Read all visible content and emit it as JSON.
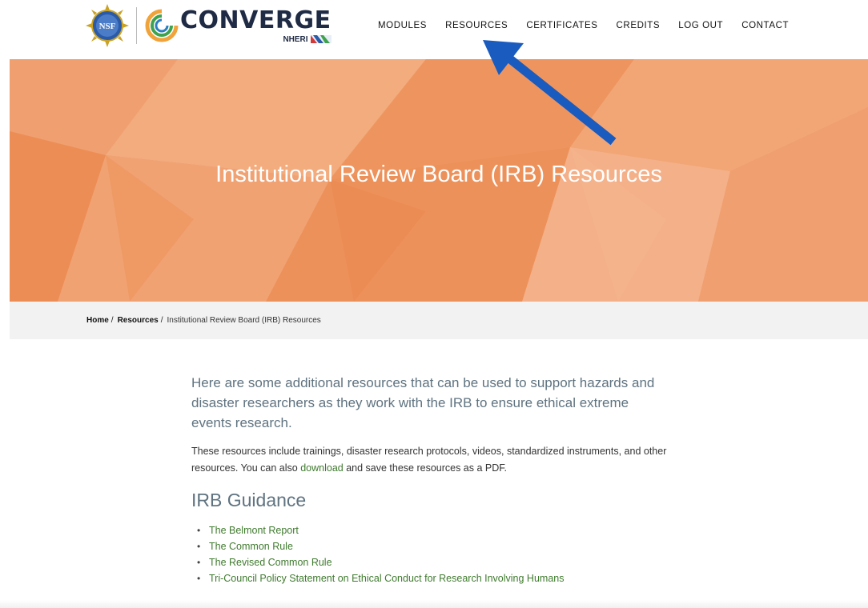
{
  "header": {
    "nsf_seal_text": "NSF",
    "brand": "CONVERGE",
    "brand_sub": "NHERI"
  },
  "nav": {
    "items": [
      "MODULES",
      "RESOURCES",
      "CERTIFICATES",
      "CREDITS",
      "LOG OUT",
      "CONTACT"
    ]
  },
  "hero": {
    "title": "Institutional Review Board (IRB) Resources",
    "background_color": "#ef9a66"
  },
  "annotation": {
    "arrow_color": "#1a5bbf",
    "points_to": "RESOURCES"
  },
  "breadcrumb": {
    "home": "Home",
    "resources": "Resources",
    "separator": "/",
    "current": "Institutional Review Board (IRB) Resources"
  },
  "content": {
    "lead": "Here are some additional resources that can be used to support hazards and disaster researchers as they work with the IRB to ensure ethical extreme events research.",
    "para_before": "These resources include trainings, disaster research protocols, videos, standardized instruments, and other resources. You can also ",
    "para_link": "download",
    "para_after": " and save these resources as a PDF.",
    "section_title": "IRB Guidance",
    "links": [
      "The Belmont Report",
      "The Common Rule",
      "The Revised Common Rule",
      "Tri-Council Policy Statement on Ethical Conduct for Research Involving Humans"
    ]
  },
  "colors": {
    "link_green": "#3f7a2e",
    "heading_slate": "#5f7380",
    "breadcrumb_bg": "#f2f2f2"
  }
}
